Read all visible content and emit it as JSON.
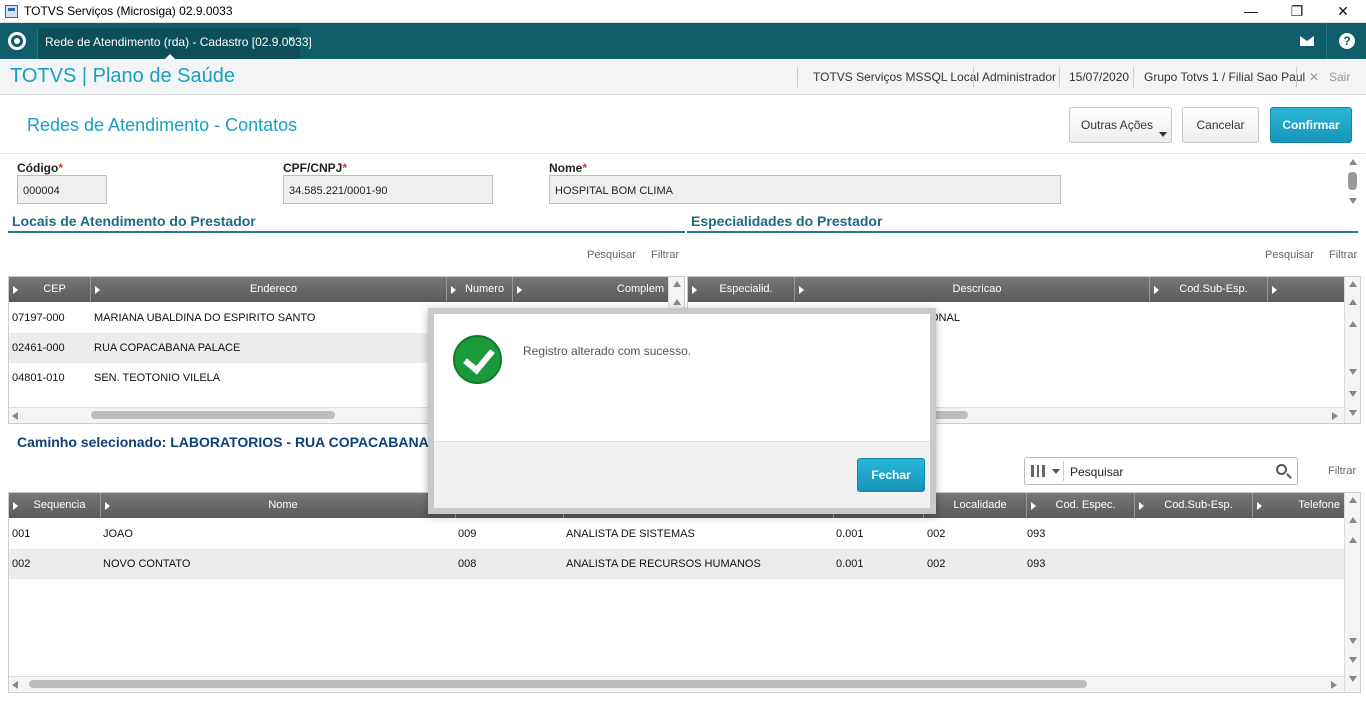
{
  "window": {
    "title": "TOTVS Serviços (Microsiga) 02.9.0033",
    "minimize": "—",
    "restore": "❐",
    "close": "✕"
  },
  "tabbar": {
    "tab_label": "Rede de Atendimento (rda) - Cadastro [02.9.0033]",
    "tab_close": "×",
    "help": "?"
  },
  "header": {
    "brand": "TOTVS | Plano de Saúde",
    "environment": "TOTVS Serviços MSSQL Local",
    "user": "Administrador",
    "date": "15/07/2020",
    "branch": "Grupo Totvs 1 / Filial Sao Paul",
    "exit_icon": "✕",
    "exit": "Sair"
  },
  "page": {
    "title": "Redes de Atendimento - Contatos",
    "other_actions": "Outras Ações",
    "cancel": "Cancelar",
    "confirm": "Confirmar"
  },
  "form": {
    "codigo_label": "Código",
    "codigo_value": "000004",
    "cpf_label": "CPF/CNPJ",
    "cpf_value": "34.585.221/0001-90",
    "nome_label": "Nome",
    "nome_value": "HOSPITAL BOM CLIMA",
    "required_mark": "*"
  },
  "locais": {
    "title": "Locais de Atendimento do Prestador",
    "search": "Pesquisar",
    "filter": "Filtrar",
    "columns": [
      "CEP",
      "Endereco",
      "Numero",
      "Complem"
    ],
    "rows": [
      [
        "07197-000",
        "MARIANA UBALDINA DO ESPIRITO SANTO",
        "",
        ""
      ],
      [
        "02461-000",
        "RUA COPACABANA PALACE",
        "",
        ""
      ],
      [
        "04801-010",
        "SEN. TEOTONIO VILELA",
        "",
        ""
      ]
    ]
  },
  "especialidades": {
    "title": "Especialidades do Prestador",
    "search": "Pesquisar",
    "filter": "Filtrar",
    "columns": [
      "Especialid.",
      "Descricao",
      "Cod.Sub-Esp."
    ],
    "rows": [
      [
        "",
        "ONAL",
        ""
      ]
    ]
  },
  "caminho": {
    "text": "Caminho selecionado: LABORATORIOS - RUA COPACABANA PAL"
  },
  "contatos": {
    "search_placeholder": "Pesquisar",
    "filter": "Filtrar",
    "columns": [
      "Sequencia",
      "Nome",
      "",
      "",
      "",
      "Localidade",
      "Cod. Espec.",
      "Cod.Sub-Esp.",
      "Telefone"
    ],
    "rows": [
      [
        "001",
        "JOAO",
        "009",
        "ANALISTA DE SISTEMAS",
        "0.001",
        "002",
        "093"
      ],
      [
        "002",
        "NOVO CONTATO",
        "008",
        "ANALISTA DE RECURSOS HUMANOS",
        "0.001",
        "002",
        "093"
      ]
    ]
  },
  "modal": {
    "message": "Registro alterado com sucesso.",
    "close": "Fechar"
  }
}
